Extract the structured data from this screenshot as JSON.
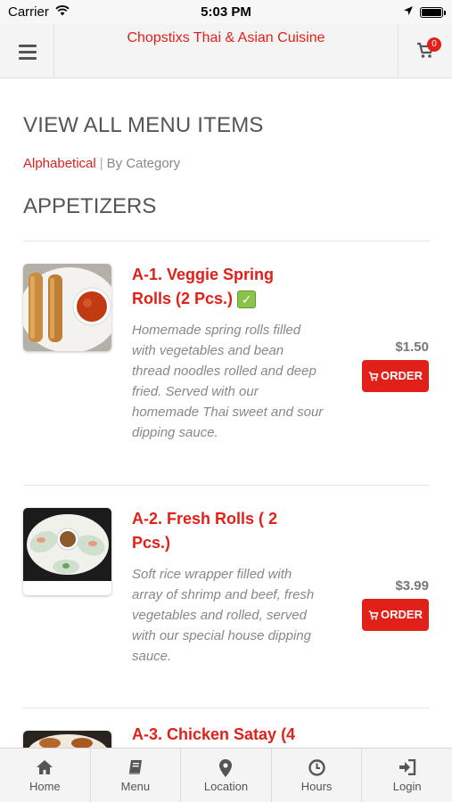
{
  "status_bar": {
    "carrier": "Carrier",
    "time": "5:03 PM"
  },
  "header": {
    "title": "Chopstixs Thai & Asian Cuisine",
    "cart_count": "0"
  },
  "page": {
    "title": "VIEW ALL MENU ITEMS",
    "filter_active": "Alphabetical",
    "filter_separator": "|",
    "filter_other": "By Category",
    "section": "APPETIZERS"
  },
  "items": [
    {
      "name": "A-1. Veggie Spring Rolls (2 Pcs.)",
      "veg_badge": "✓",
      "description": "Homemade spring rolls filled with vegetables and bean thread noodles rolled and deep fried. Served with our homemade Thai sweet and sour dipping sauce.",
      "price": "$1.50",
      "button": "ORDER"
    },
    {
      "name": "A-2. Fresh Rolls ( 2 Pcs.)",
      "description": "Soft rice wrapper filled with array of shrimp and beef, fresh vegetables and rolled, served with our special house dipping sauce.",
      "price": "$3.99",
      "button": "ORDER"
    },
    {
      "name": "A-3. Chicken Satay (4"
    }
  ],
  "tabs": [
    {
      "label": "Home",
      "icon": "home-icon"
    },
    {
      "label": "Menu",
      "icon": "book-icon"
    },
    {
      "label": "Location",
      "icon": "map-marker-icon"
    },
    {
      "label": "Hours",
      "icon": "clock-icon"
    },
    {
      "label": "Login",
      "icon": "sign-in-icon"
    }
  ],
  "colors": {
    "accent": "#e2201a",
    "veg_badge": "#8bc34a",
    "bar_bg": "#f4f4f4"
  }
}
